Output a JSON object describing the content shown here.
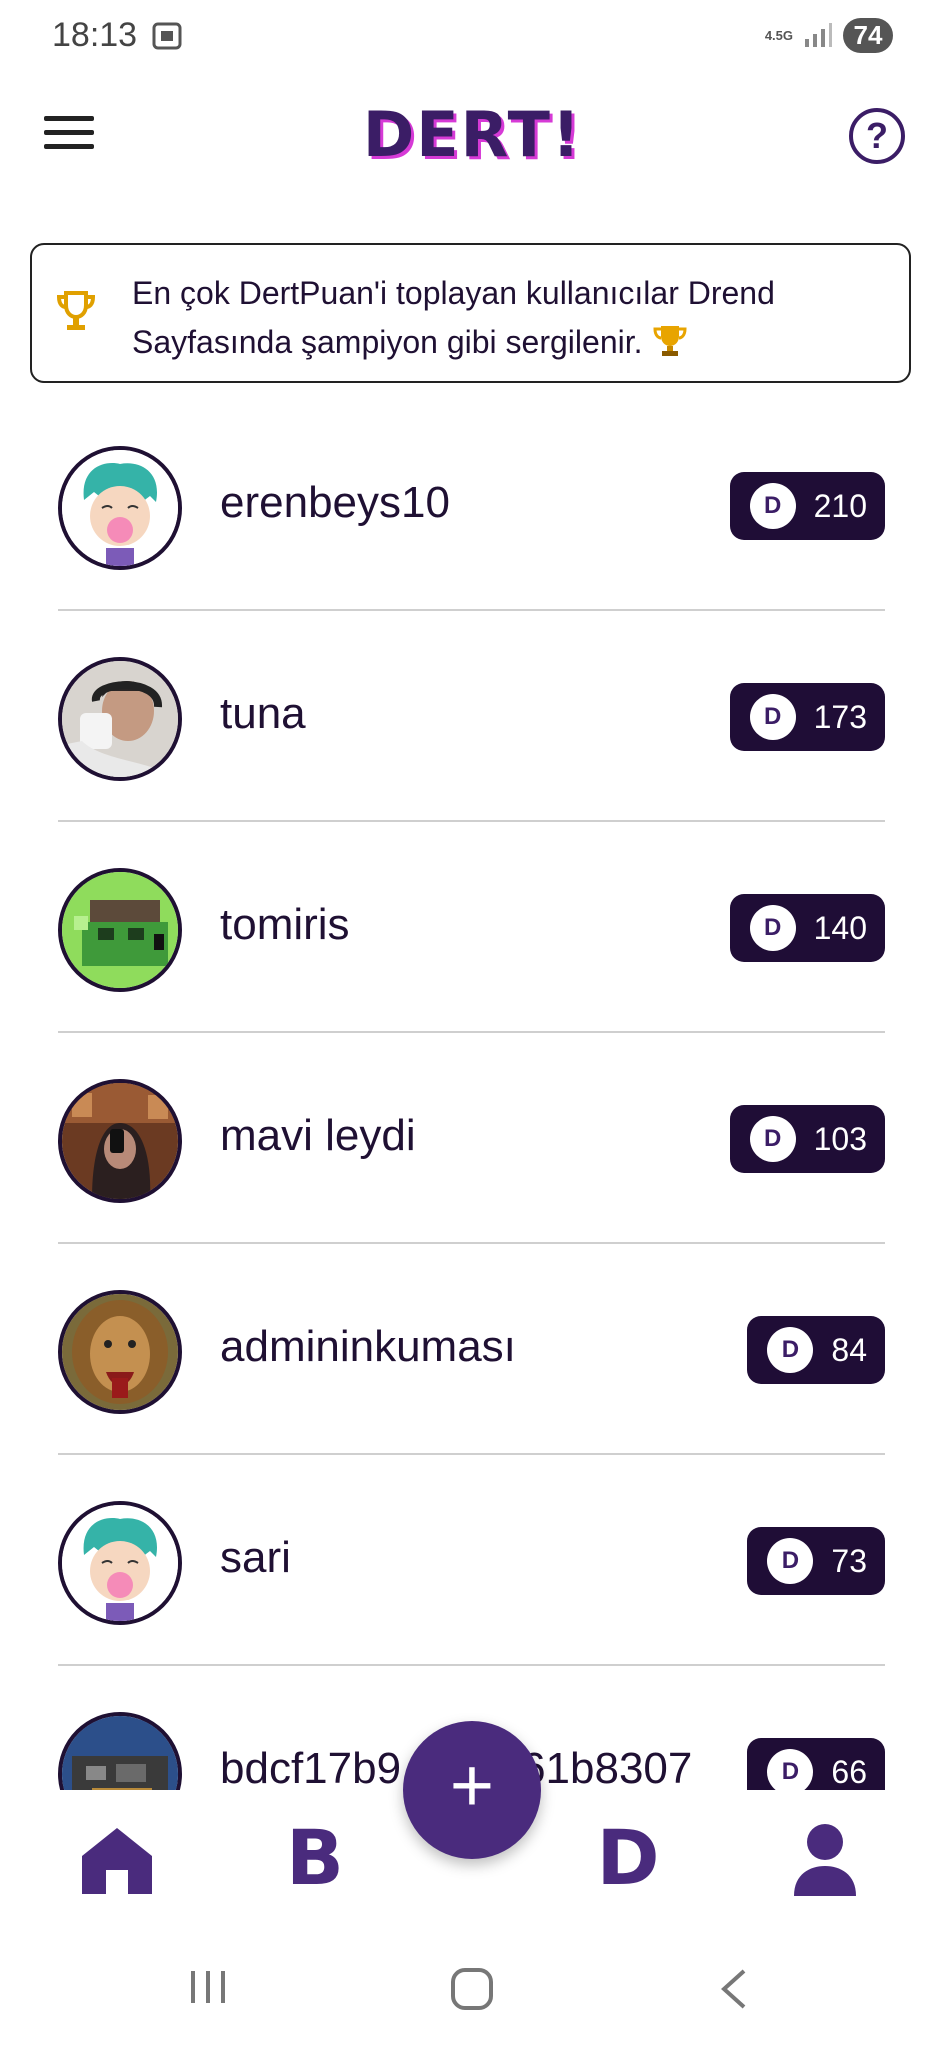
{
  "status_bar": {
    "time": "18:13",
    "network": "4.5G",
    "battery": "74"
  },
  "app_bar": {
    "logo": "DERT!",
    "help_label": "?"
  },
  "banner": {
    "text": "En çok DertPuan'i toplayan kullanıcılar Drend Sayfasında şampiyon gibi sergilenir."
  },
  "coin_letter": "D",
  "users": [
    {
      "name": "erenbeys10",
      "points": "210",
      "avatar": "cartoon-bubblegum-avatar"
    },
    {
      "name": "tuna",
      "points": "173",
      "avatar": "photo-person-mug-avatar"
    },
    {
      "name": "tomiris",
      "points": "140",
      "avatar": "pixel-zombie-avatar"
    },
    {
      "name": "mavi leydi",
      "points": "103",
      "avatar": "photo-mirror-selfie-avatar"
    },
    {
      "name": "admininkuması",
      "points": "84",
      "avatar": "photo-lion-avatar"
    },
    {
      "name": "sari",
      "points": "73",
      "avatar": "cartoon-bubblegum-avatar"
    },
    {
      "name": "bdcf17b9",
      "name_end": "61b8307",
      "points": "66",
      "avatar": "photo-car-engine-avatar"
    }
  ],
  "bottom_nav": {
    "b_label": "B",
    "d_label": "D",
    "fab_label": "+"
  },
  "colors": {
    "primary": "#4a2b7d",
    "pill": "#1f0d36",
    "logo_shadow": "#d63ad6",
    "trophy": "#e0a000"
  }
}
